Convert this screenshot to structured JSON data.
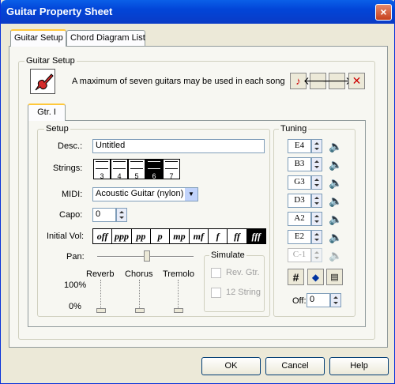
{
  "window": {
    "title": "Guitar Property Sheet",
    "close": "×"
  },
  "tabs": [
    "Guitar Setup",
    "Chord Diagram List"
  ],
  "guitar_setup": {
    "group_label": "Guitar Setup",
    "info": "A maximum of seven guitars may be used in each song",
    "toolbar": {
      "prev": "🡐",
      "next": "🡒",
      "delete": "✕"
    }
  },
  "gtr_tab": "Gtr. I",
  "setup": {
    "group_label": "Setup",
    "desc_label": "Desc.:",
    "desc_value": "Untitled",
    "strings_label": "Strings:",
    "strings": [
      "3",
      "4",
      "5",
      "6",
      "7"
    ],
    "strings_selected": "6",
    "midi_label": "MIDI:",
    "midi_value": "Acoustic Guitar (nylon)",
    "capo_label": "Capo:",
    "capo_value": "0",
    "vol_label": "Initial Vol:",
    "volumes": [
      "off",
      "ppp",
      "pp",
      "p",
      "mp",
      "mf",
      "f",
      "ff",
      "fff"
    ],
    "vol_selected": "fff",
    "pan_label": "Pan:",
    "reverb_label": "Reverb",
    "chorus_label": "Chorus",
    "tremolo_label": "Tremolo",
    "pct_100": "100%",
    "pct_0": "0%"
  },
  "simulate": {
    "group_label": "Simulate",
    "rev_gtr": "Rev. Gtr.",
    "twelve_string": "12 String"
  },
  "tuning": {
    "group_label": "Tuning",
    "strings": [
      "E4",
      "B3",
      "G3",
      "D3",
      "A2",
      "E2",
      "C-1"
    ],
    "sharp": "#",
    "off_label": "Off:",
    "off_value": "0"
  },
  "buttons": {
    "ok": "OK",
    "cancel": "Cancel",
    "help": "Help"
  }
}
